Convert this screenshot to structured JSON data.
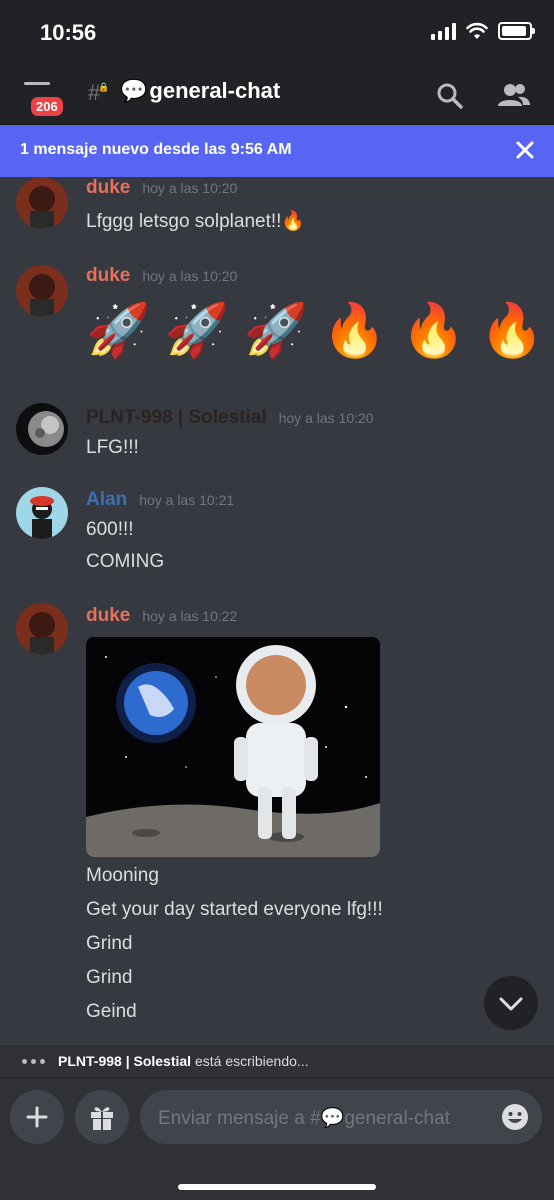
{
  "status_bar": {
    "time": "10:56"
  },
  "header": {
    "unread_badge": "206",
    "channel_emoji": "💬",
    "channel_name": "general-chat",
    "hash": "#"
  },
  "banner": {
    "text": "1 mensaje nuevo desde las 9:56 AM"
  },
  "messages": [
    {
      "author": "duke",
      "author_color": "#e8705b",
      "timestamp": "hoy a las 10:20",
      "lines": [
        "Lfggg letsgo solplanet!!🔥"
      ]
    },
    {
      "author": "duke",
      "author_color": "#e8705b",
      "timestamp": "hoy a las 10:20",
      "emoji_line": [
        "🚀",
        "🚀",
        "🚀",
        "🔥",
        "🔥",
        "🔥",
        "🔥"
      ]
    },
    {
      "author": "PLNT-998 | Solestial",
      "author_color": "#2b2320",
      "timestamp": "hoy a las 10:20",
      "lines": [
        "LFG!!!"
      ]
    },
    {
      "author": "Alan",
      "author_color": "#3d6fb5",
      "timestamp": "hoy a las 10:21",
      "lines": [
        "600!!!",
        "COMING"
      ]
    },
    {
      "author": "duke",
      "author_color": "#e8705b",
      "timestamp": "hoy a las 10:22",
      "attachment": "gif",
      "lines": [
        "Mooning",
        "Get your day started everyone lfg!!!",
        "Grind",
        "Grind",
        "Geind"
      ]
    }
  ],
  "typing": {
    "user": "PLNT-998 | Solestial",
    "suffix": " está escribiendo..."
  },
  "composer": {
    "placeholder_prefix": "Enviar mensaje a #",
    "channel_emoji": "💬",
    "channel_name": "general-chat"
  },
  "colors": {
    "accent": "#5865f2",
    "background": "#36393f",
    "header": "#202225",
    "badge": "#ed4245"
  }
}
